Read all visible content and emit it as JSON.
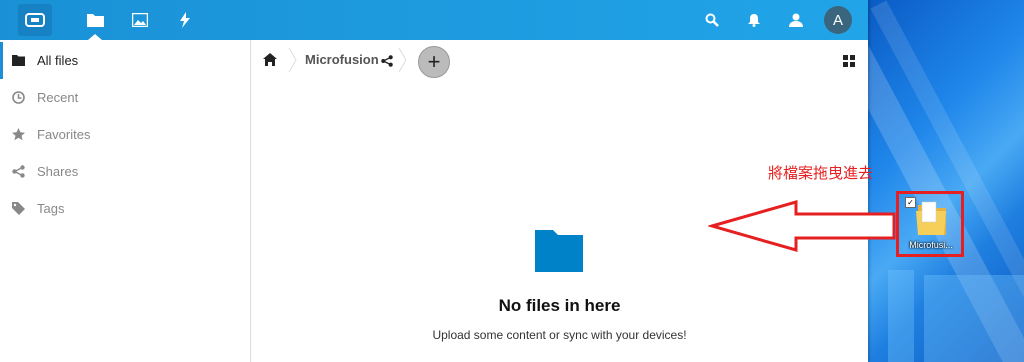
{
  "topbar": {
    "nav_icons": [
      "files-icon",
      "gallery-icon",
      "activity-icon"
    ],
    "right_icons": [
      "search-icon",
      "bell-icon",
      "contacts-icon"
    ],
    "avatar_letter": "A",
    "colors": {
      "bar": "#1a91d6",
      "avatar": "#39657e"
    }
  },
  "sidebar": {
    "items": [
      {
        "label": "All files",
        "icon": "folder-icon",
        "active": true
      },
      {
        "label": "Recent",
        "icon": "clock-icon",
        "active": false
      },
      {
        "label": "Favorites",
        "icon": "star-icon",
        "active": false
      },
      {
        "label": "Shares",
        "icon": "share-icon",
        "active": false
      },
      {
        "label": "Tags",
        "icon": "tag-icon",
        "active": false
      }
    ]
  },
  "breadcrumb": {
    "home_icon": "home-icon",
    "folder": "Microfusion",
    "share_icon": "share-icon",
    "add_label": "+"
  },
  "empty_state": {
    "title": "No files in here",
    "subtitle": "Upload some content or sync with your devices!",
    "folder_color": "#0082c9"
  },
  "annotation": {
    "text": "將檔案拖曳進去",
    "color": "#e62020"
  },
  "desktop": {
    "icon_label": "Microfusi..."
  }
}
